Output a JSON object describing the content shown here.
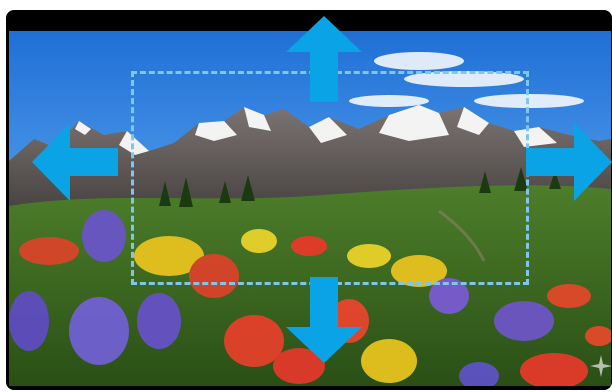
{
  "editor": {
    "image_subject": "alpine-mountain-wildflower-meadow",
    "crop_frame_style": "dashed",
    "accent_color": "#0aa3e6",
    "crop_border_color": "#7fc6ec",
    "handles": [
      {
        "direction": "up",
        "icon": "arrow-up-icon"
      },
      {
        "direction": "down",
        "icon": "arrow-down-icon"
      },
      {
        "direction": "left",
        "icon": "arrow-left-icon"
      },
      {
        "direction": "right",
        "icon": "arrow-right-icon"
      }
    ],
    "watermark_icon": "sparkle-icon"
  }
}
